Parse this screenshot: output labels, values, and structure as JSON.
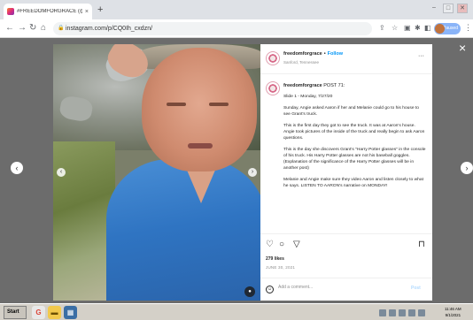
{
  "browser": {
    "tab_title": "#FREEDOMFORGRACE (@freedo...",
    "tab_close": "×",
    "new_tab": "+",
    "url": "instagram.com/p/CQ0Ih_cxdzn/",
    "profile_label": "Paused"
  },
  "overlay": {
    "close": "×",
    "prev": "‹",
    "next": "›"
  },
  "post": {
    "username": "freedomforgrace",
    "follow": "Follow",
    "sub": "Sanford, Tennessee",
    "caption_user": "freedomforgrace",
    "caption_title": "POST 71:",
    "paragraphs": [
      "Slide 1 - Monday, 7/27/20",
      "Sunday, Angie asked Aaron if her and Melanie could go to his house to see Grant's truck.",
      "This is the first day they got to see the truck. It was at Aaron's house. Angie took pictures of the inside of the truck and really begin to ask Aaron questions.",
      "This is the day she discovers Grant's \"Harry Potter glasses\" in the console of his truck. His Harry Potter glasses are not his baseball goggles. (Explanation of the significance of the Harry Potter glasses will be in another post)",
      "Melanie and Angie make sure they video Aaron and listen closely to what he says. LISTEN TO AARON's narrative on MONDAY!"
    ],
    "likes": "279 likes",
    "date": "JUNE 30, 2021",
    "comment_placeholder": "Add a comment...",
    "post_button": "Post"
  },
  "icons": {
    "heart": "heart-icon",
    "comment": "comment-icon",
    "share": "share-icon",
    "bookmark": "bookmark-icon"
  },
  "taskbar": {
    "start": "Start",
    "time": "11:46 AM",
    "date": "9/1/2021"
  }
}
